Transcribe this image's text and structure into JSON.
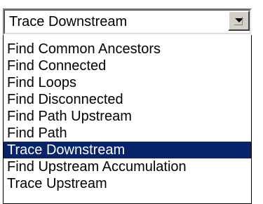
{
  "combo": {
    "selected_value": "Trace Downstream",
    "button_icon": "chevron-down-icon"
  },
  "list": {
    "items": [
      {
        "label": "Find Common Ancestors",
        "selected": false
      },
      {
        "label": "Find Connected",
        "selected": false
      },
      {
        "label": "Find Loops",
        "selected": false
      },
      {
        "label": "Find Disconnected",
        "selected": false
      },
      {
        "label": "Find Path Upstream",
        "selected": false
      },
      {
        "label": "Find Path",
        "selected": false
      },
      {
        "label": "Trace Downstream",
        "selected": true
      },
      {
        "label": "Find Upstream Accumulation",
        "selected": false
      },
      {
        "label": "Trace Upstream",
        "selected": false
      }
    ]
  },
  "colors": {
    "selection_background": "#0a246a",
    "selection_text": "#ffffff",
    "control_face": "#d4d0c8"
  }
}
